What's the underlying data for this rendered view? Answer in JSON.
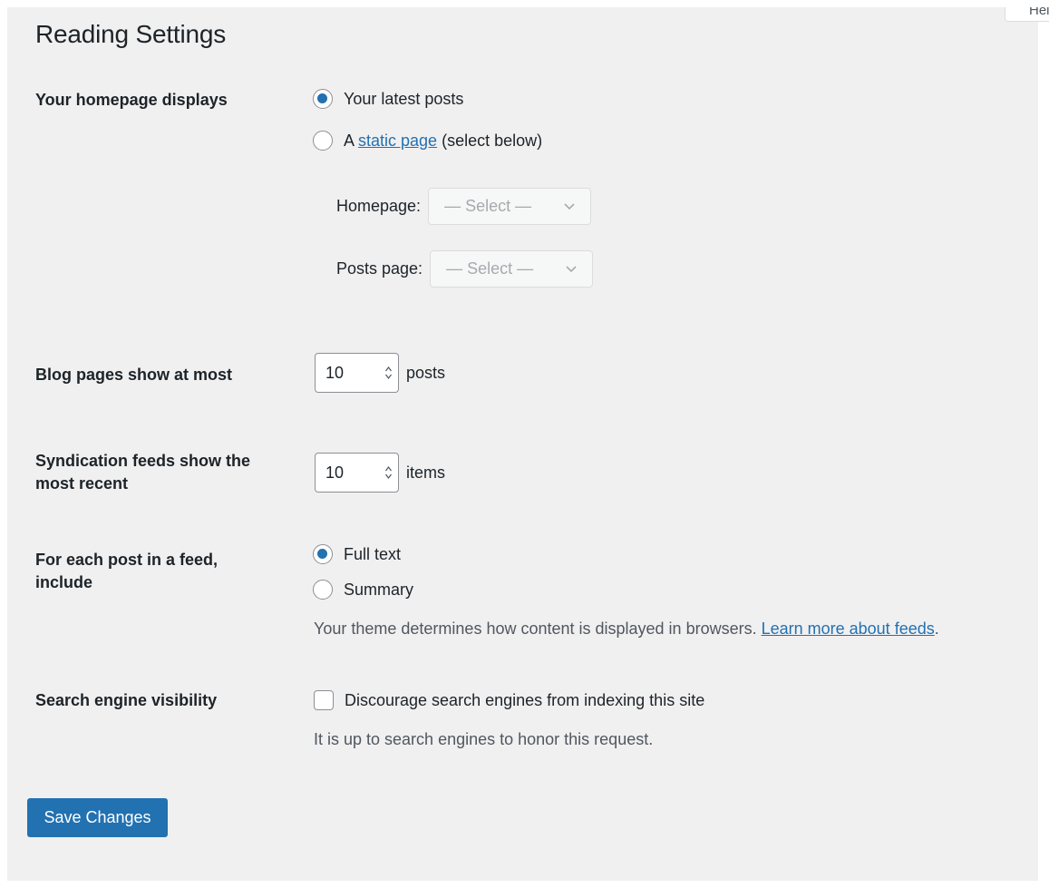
{
  "help_tab": {
    "label": "Help"
  },
  "page": {
    "title": "Reading Settings"
  },
  "homepage_displays": {
    "label": "Your homepage displays",
    "options": [
      {
        "text": "Your latest posts",
        "checked": true
      },
      {
        "prefix": "A ",
        "link_text": "static page",
        "suffix": " (select below)",
        "checked": false
      }
    ],
    "homepage_select": {
      "label": "Homepage:",
      "value": "— Select —"
    },
    "posts_page_select": {
      "label": "Posts page:",
      "value": "— Select —"
    }
  },
  "blog_pages": {
    "label": "Blog pages show at most",
    "value": "10",
    "unit": "posts"
  },
  "syndication": {
    "label_line1": "Syndication feeds show the",
    "label_line2": "most recent",
    "value": "10",
    "unit": "items"
  },
  "feed_content": {
    "label_line1": "For each post in a feed,",
    "label_line2": "include",
    "options": [
      {
        "text": "Full text",
        "checked": true
      },
      {
        "text": "Summary",
        "checked": false
      }
    ],
    "description": "Your theme determines how content is displayed in browsers. ",
    "link_text": "Learn more about feeds",
    "link_suffix": "."
  },
  "search_visibility": {
    "label": "Search engine visibility",
    "checkbox_label": "Discourage search engines from indexing this site",
    "checked": false,
    "description": "It is up to search engines to honor this request."
  },
  "save_button": {
    "label": "Save Changes"
  },
  "colors": {
    "accent": "#2271b1",
    "background": "#f0f0f1",
    "text": "#1d2327",
    "muted_text": "#50575e"
  }
}
